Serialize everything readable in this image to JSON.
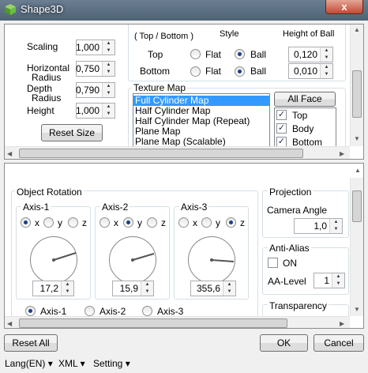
{
  "window": {
    "title": "Shape3D",
    "close_symbol": "x"
  },
  "top_panel": {
    "scaling_label": "Scaling",
    "scaling_value": "1,000",
    "horizontal_label": "Horizontal",
    "radius_label": "Radius",
    "horizontal_value": "0,750",
    "depth_label": "Depth",
    "depth_value": "0,790",
    "height_label": "Height",
    "height_value": "1,000",
    "reset_size": "Reset Size",
    "cut_header_left": "( Top / Bottom )",
    "cut_header_mid": "Style",
    "cut_header_right": "Height of Ball",
    "top_label": "Top",
    "bottom_label": "Bottom",
    "flat_label": "Flat",
    "ball_label": "Ball",
    "top_height": "0,120",
    "bottom_height": "0,010",
    "texture_map_label": "Texture Map",
    "texture_items": [
      "Full Cylinder Map",
      "Half Cylinder Map",
      "Half Cylinder Map (Repeat)",
      "Plane Map",
      "Plane Map (Scalable)"
    ],
    "all_face": "All Face",
    "faces": [
      "Top",
      "Body",
      "Bottom"
    ]
  },
  "bottom_panel": {
    "object_rotation": "Object Rotation",
    "axis1": "Axis-1",
    "axis2": "Axis-2",
    "axis3": "Axis-3",
    "x": "x",
    "y": "y",
    "z": "z",
    "axis1_value": "17,2",
    "axis2_value": "15,9",
    "axis3_value": "355,6",
    "projection": "Projection",
    "camera_angle": "Camera Angle",
    "camera_value": "1,0",
    "anti_alias": "Anti-Alias",
    "on_label": "ON",
    "aa_level": "AA-Level",
    "aa_value": "1",
    "transparency": "Transparency"
  },
  "footer": {
    "reset_all": "Reset All",
    "ok": "OK",
    "cancel": "Cancel"
  },
  "menu": {
    "lang": "Lang(EN)",
    "xml": "XML",
    "setting": "Setting",
    "arrow": "▾"
  }
}
